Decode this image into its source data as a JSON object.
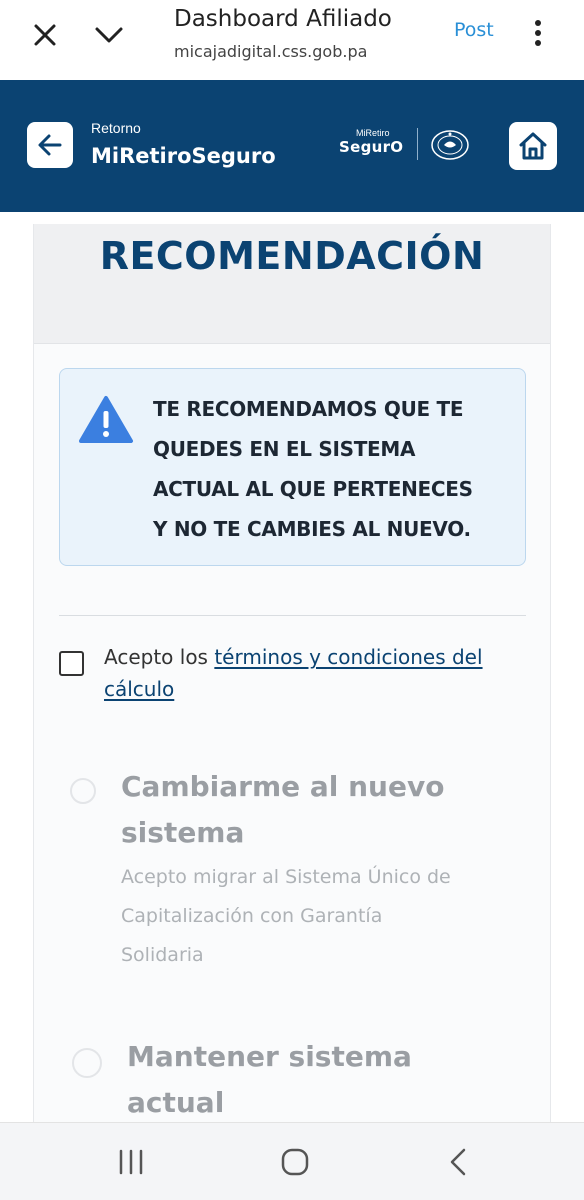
{
  "browser": {
    "title": "Dashboard Afiliado",
    "url": "micajadigital.css.gob.pa",
    "post_label": "Post"
  },
  "header": {
    "subtitle": "Retorno",
    "title": "MiRetiroSeguro",
    "brand_small": "MiRetiro",
    "brand_big": "SegurO"
  },
  "main": {
    "section_title": "RECOMENDACIÓN",
    "alert": {
      "icon": "warning-triangle-icon",
      "lines": [
        "TE RECOMENDAMOS QUE TE",
        "QUEDES EN EL SISTEMA",
        "ACTUAL AL QUE PERTENECES",
        "Y NO TE CAMBIES AL NUEVO."
      ]
    },
    "terms": {
      "prefix": "Acepto los ",
      "link": "términos y condiciones del cálculo",
      "checked": false
    },
    "options": [
      {
        "title_lines": [
          "Cambiarme al nuevo",
          "sistema"
        ],
        "desc_lines": [
          "Acepto migrar al Sistema Único de",
          "Capitalización con Garantía",
          "Solidaria"
        ],
        "selected": false
      },
      {
        "title_lines": [
          "Mantener sistema",
          "actual"
        ],
        "selected": false
      }
    ]
  },
  "colors": {
    "brand_navy": "#0b4372",
    "alert_bg": "#eaf3fb",
    "warning_blue": "#3b7fe0",
    "link": "#2a8fd6"
  }
}
